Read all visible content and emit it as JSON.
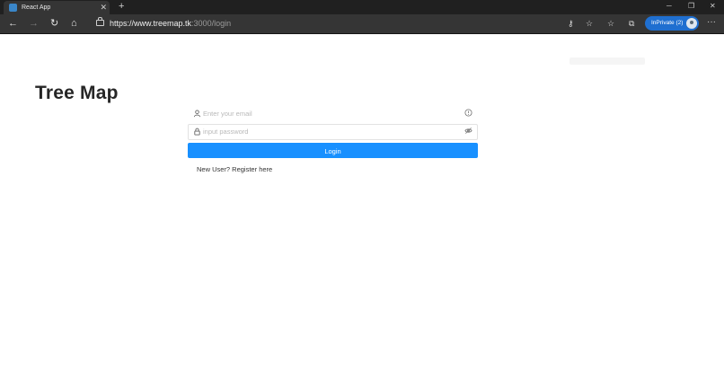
{
  "browser": {
    "tab_title": "React App",
    "url_host": "https://www.treemap.tk",
    "url_path": ":3000/login",
    "inprivate_label": "InPrivate (2)"
  },
  "app": {
    "title": "Tree Map",
    "email_placeholder": "Enter your email",
    "password_placeholder": "input password",
    "login_label": "Login",
    "register_link": "New User? Register here"
  },
  "colors": {
    "accent": "#1890ff",
    "browser_chrome": "#353535",
    "inprivate": "#1f6fd0"
  },
  "icons": {
    "email_prefix": "user-icon",
    "email_suffix": "info-icon",
    "password_prefix": "lock-icon",
    "password_suffix": "eye-invisible-icon"
  }
}
